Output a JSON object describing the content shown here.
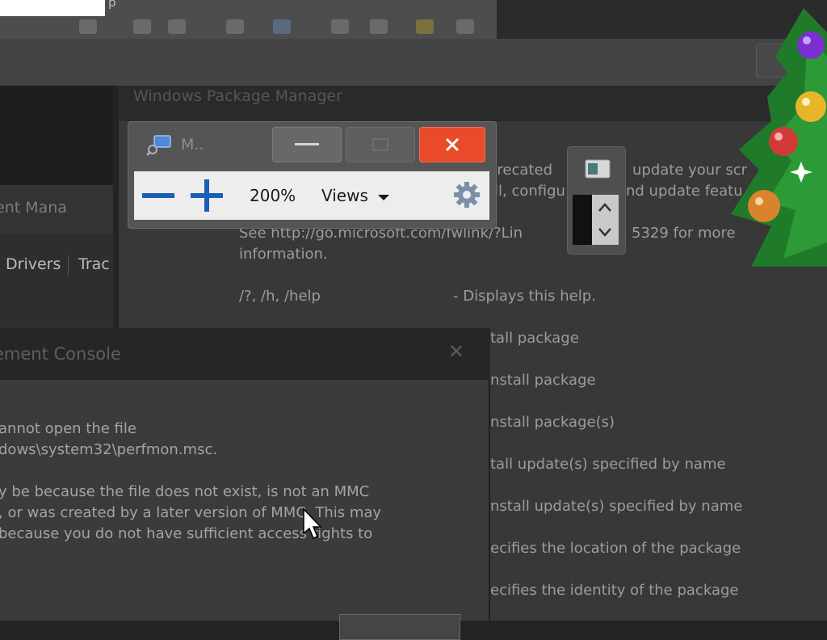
{
  "topbar": {
    "fragment": "p"
  },
  "left_pane": {
    "title": "ent Mana",
    "tabs": [
      {
        "label": "Drivers"
      },
      {
        "label": "Trac"
      }
    ]
  },
  "dism_window": {
    "title": "Windows Package Manager",
    "lines": [
      "precated",
      "update your scr",
      "ll, configu",
      "nd update featu",
      "See http://go.microsoft.com/fwlink/?Lin",
      "5329 for more",
      "information.",
      "/?, /h, /help",
      "- Displays this help.",
      "tall package",
      "nstall package",
      "nstall package(s)",
      "tall update(s) specified by name",
      "nstall update(s) specified by name",
      "ecifies the location of the package",
      "ecifies the identity of the package"
    ]
  },
  "error_dialog": {
    "title": "ement Console",
    "close_glyph": "✕",
    "lines": [
      "annot open the file",
      "dows\\system32\\perfmon.msc.",
      "y be because the file does not exist, is not an MMC",
      ", or was created by a later version of MMC. This may",
      " because you do not have sufficient access rights to"
    ]
  },
  "magnifier": {
    "title": "M..",
    "zoom_level": "200%",
    "views_label": "Views",
    "icons": {
      "app": "magnifier-icon",
      "minimize": "minimize-icon",
      "maximize": "maximize-icon",
      "close": "close-icon",
      "zoom_out": "zoom-out-icon",
      "zoom_in": "zoom-in-icon",
      "dropdown": "chevron-down-icon",
      "options": "gear-icon"
    },
    "colors": {
      "close_button": "#e84a2a",
      "zoom_glyph": "#1a5fb4",
      "toolbar_bg": "#ededed"
    }
  },
  "mini_widget": {
    "icons": [
      "window-icon",
      "chevron-up-icon",
      "chevron-down-icon"
    ]
  },
  "decoration": {
    "icon": "christmas-tree-icon"
  }
}
